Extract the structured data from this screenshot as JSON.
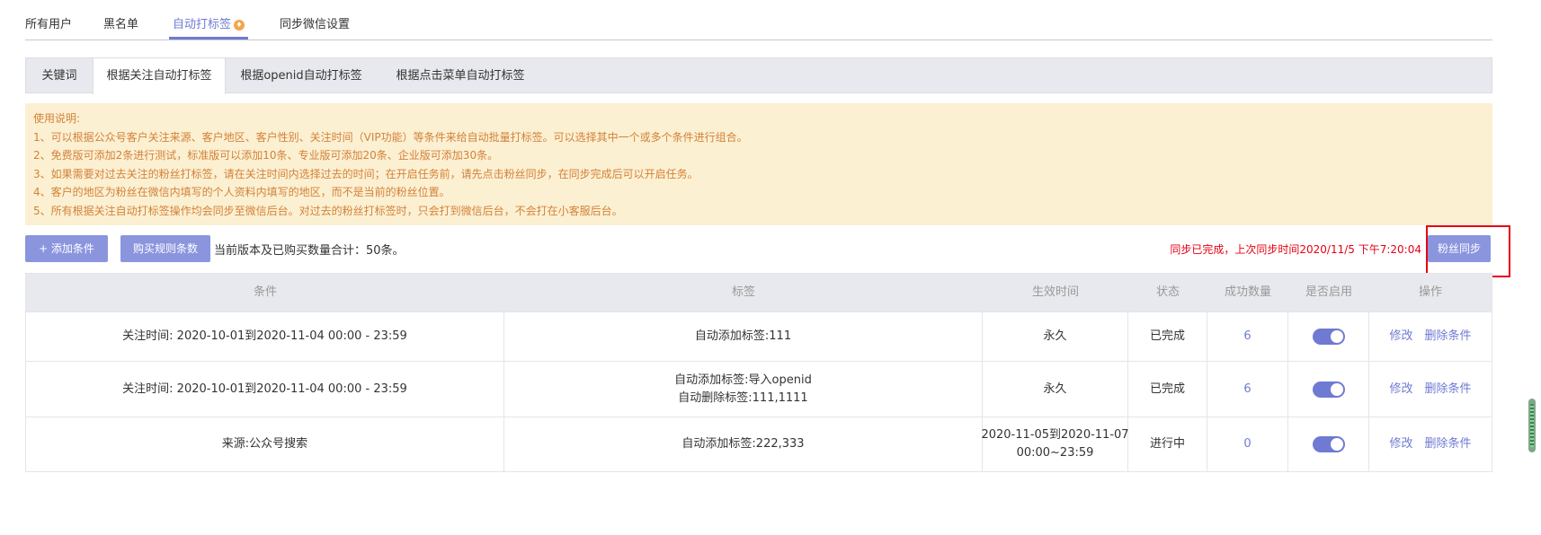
{
  "top_tabs": [
    {
      "label": "所有用户"
    },
    {
      "label": "黑名单"
    },
    {
      "label": "自动打标签"
    },
    {
      "label": "同步微信设置"
    }
  ],
  "sub_tabs": [
    {
      "label": "关键词"
    },
    {
      "label": "根据关注自动打标签"
    },
    {
      "label": "根据openid自动打标签"
    },
    {
      "label": "根据点击菜单自动打标签"
    }
  ],
  "notice": {
    "title": "使用说明:",
    "lines": [
      "1、可以根据公众号客户关注来源、客户地区、客户性别、关注时间（VIP功能）等条件来给自动批量打标签。可以选择其中一个或多个条件进行组合。",
      "2、免费版可添加2条进行测试，标准版可以添加10条、专业版可添加20条、企业版可添加30条。",
      "3、如果需要对过去关注的粉丝打标签，请在关注时间内选择过去的时间；在开启任务前，请先点击粉丝同步，在同步完成后可以开启任务。",
      "4、客户的地区为粉丝在微信内填写的个人资料内填写的地区，而不是当前的粉丝位置。",
      "5、所有根据关注自动打标签操作均会同步至微信后台。对过去的粉丝打标签时，只会打到微信后台，不会打在小客服后台。"
    ]
  },
  "toolbar": {
    "add_condition_label": "+ 添加条件",
    "buy_rules_label": "购买规则条数",
    "total_text": "当前版本及已购买数量合计：50条。",
    "sync_status": "同步已完成，上次同步时间2020/11/5 下午7:20:04",
    "sync_button_label": "粉丝同步"
  },
  "table": {
    "headers": [
      "条件",
      "标签",
      "生效时间",
      "状态",
      "成功数量",
      "是否启用",
      "操作"
    ],
    "rows": [
      {
        "condition": "关注时间: 2020-10-01到2020-11-04 00:00 - 23:59",
        "tag_line1": "自动添加标签:111",
        "tag_line2": "",
        "time_line1": "永久",
        "time_line2": "",
        "status": "已完成",
        "count": "6",
        "enabled": true,
        "edit_label": "修改",
        "delete_label": "删除条件"
      },
      {
        "condition": "关注时间: 2020-10-01到2020-11-04 00:00 - 23:59",
        "tag_line1": "自动添加标签:导入openid",
        "tag_line2": "自动删除标签:111,1111",
        "time_line1": "永久",
        "time_line2": "",
        "status": "已完成",
        "count": "6",
        "enabled": true,
        "edit_label": "修改",
        "delete_label": "删除条件"
      },
      {
        "condition": "来源:公众号搜索",
        "tag_line1": "自动添加标签:222,333",
        "tag_line2": "",
        "time_line1": "2020-11-05到2020-11-07",
        "time_line2": "00:00~23:59",
        "status": "进行中",
        "count": "0",
        "enabled": true,
        "edit_label": "修改",
        "delete_label": "删除条件"
      }
    ]
  },
  "colors": {
    "accent": "#6f7ad3",
    "button": "#8b95de",
    "notice_bg": "#fcf0d2",
    "notice_text": "#d2823a",
    "sync_status": "#e60012",
    "highlight_border": "#e60012"
  }
}
